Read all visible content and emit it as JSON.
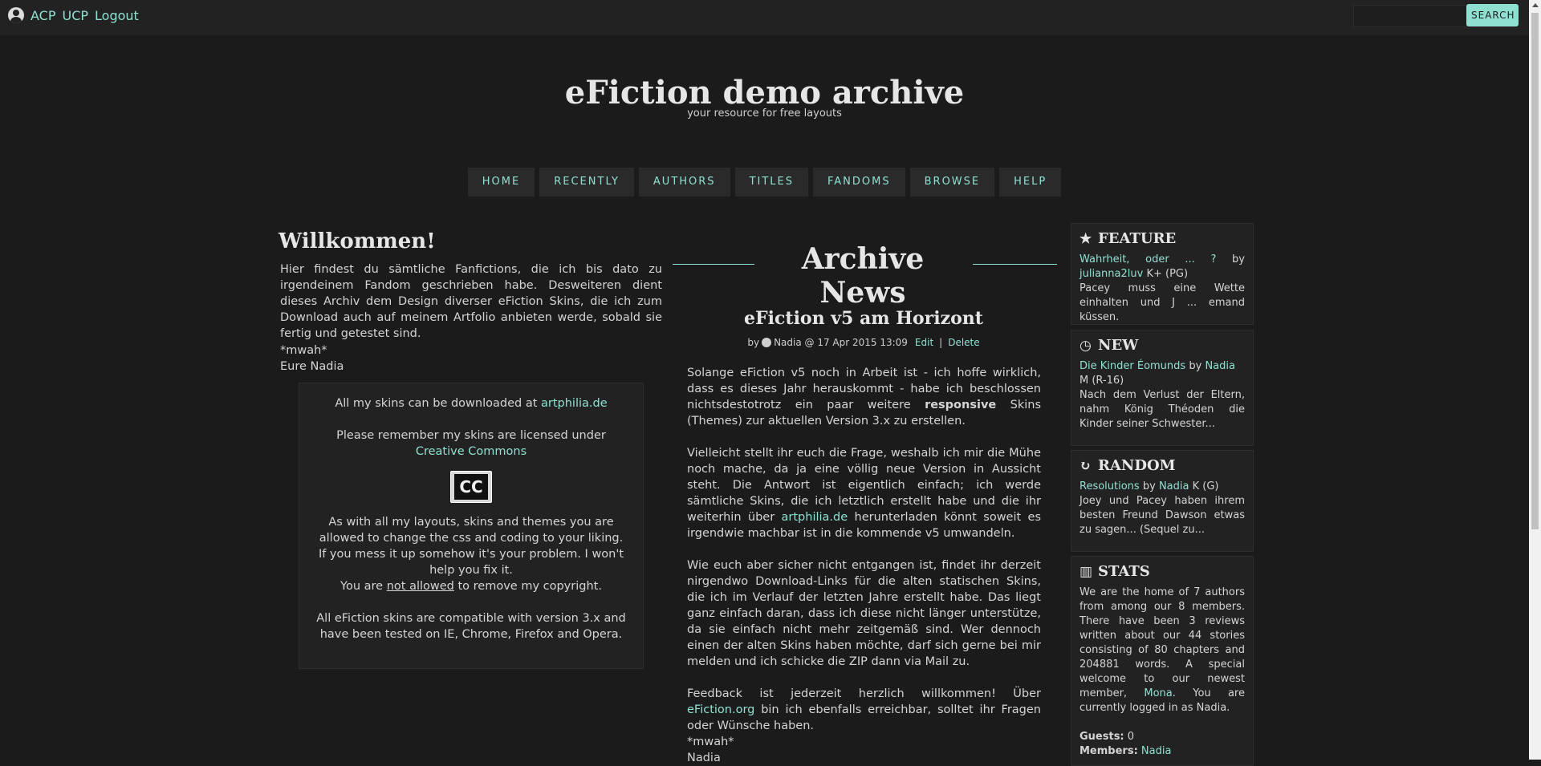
{
  "user_links": [
    "ACP",
    "UCP",
    "Logout"
  ],
  "search": {
    "button": "SEARCH",
    "value": ""
  },
  "header": {
    "title": "eFiction demo archive",
    "tagline": "your resource for free layouts"
  },
  "nav": [
    "HOME",
    "RECENTLY",
    "AUTHORS",
    "TITLES",
    "FANDOMS",
    "BROWSE",
    "HELP"
  ],
  "welcome": {
    "title": "Willkommen!",
    "text": "Hier findest du sämtliche Fanfictions, die ich bis dato zu irgendeinem Fandom geschrieben habe. Desweiteren dient dieses Archiv dem Design diverser eFiction Skins, die ich zum Download auch auf meinem Artfolio anbieten werde, sobald sie fertig und getestet sind.",
    "sig1": "*mwah*",
    "sig2": "Eure Nadia"
  },
  "skin_box": {
    "line1_pre": "All my skins can be downloaded at",
    "line1_link": "artphilia.de",
    "line2_pre": "Please remember my skins are licensed under",
    "line2_link": "Creative Commons",
    "cc": "CC",
    "para1": "As with all my layouts, skins and themes you are allowed to change the css and coding to your liking.",
    "para2": "If you mess it up somehow it's your problem. I won't help you fix it.",
    "para3_pre": "You are",
    "para3_u": "not allowed",
    "para3_post": "to remove my copyright.",
    "para4": "All eFiction skins are compatible with version 3.x and have been tested on IE, Chrome, Firefox and Opera."
  },
  "news": {
    "heading": "Archive News",
    "title": "eFiction v5 am Horizont",
    "meta_by": "by",
    "meta_author": "Nadia @ 17 Apr 2015 13:09",
    "edit": "Edit",
    "sep": "|",
    "delete": "Delete",
    "p1_a": "Solange eFiction v5 noch in Arbeit ist - ich hoffe wirklich, dass es dieses Jahr herauskommt - habe ich beschlossen nichtsdestotrotz ein paar weitere",
    "p1_b": "responsive",
    "p1_c": "Skins (Themes) zur aktuellen Version 3.x zu erstellen.",
    "p2_a": "Vielleicht stellt ihr euch die Frage, weshalb ich mir die Mühe noch mache, da ja eine völlig neue Version in Aussicht steht. Die Antwort ist eigentlich einfach; ich werde sämtliche Skins, die ich letztlich erstellt habe und die ihr weiterhin über",
    "p2_link": "artphilia.de",
    "p2_b": "herunterladen könnt soweit es irgendwie machbar ist in die kommende v5 umwandeln.",
    "p3": "Wie euch aber sicher nicht entgangen ist, findet ihr derzeit nirgendwo Download-Links für die alten statischen Skins, die ich im Verlauf der letzten Jahre erstellt habe. Das liegt ganz einfach daran, dass ich diese nicht länger unterstütze, da sie einfach nicht mehr zeitgemäß sind. Wer dennoch einen der alten Skins haben möchte, darf sich gerne bei mir melden und ich schicke die ZIP dann via Mail zu.",
    "p4_a": "Feedback ist jederzeit herzlich willkommen! Über",
    "p4_link": "eFiction.org",
    "p4_b": "bin ich ebenfalls erreichbar, solltet ihr Fragen oder Wünsche haben.",
    "sig1": "*mwah*",
    "sig2": "Nadia"
  },
  "sidebar": {
    "feature": {
      "title": "FEATURE",
      "story": "Wahrheit, oder ... ?",
      "by": "by",
      "author": "julianna2luv",
      "rating": "K+ (PG)",
      "summary": "Pacey muss eine Wette einhalten und J ... emand küssen."
    },
    "new": {
      "title": "NEW",
      "story": "Die Kinder Éomunds",
      "by": "by",
      "author": "Nadia",
      "rating": "M (R-16)",
      "summary": "Nach dem Verlust der Eltern, nahm König Théoden die Kinder seiner Schwester..."
    },
    "random": {
      "title": "RANDOM",
      "story": "Resolutions",
      "by": "by",
      "author": "Nadia",
      "rating": "K (G)",
      "summary": "Joey und Pacey haben ihrem besten Freund Dawson etwas zu sagen... (Sequel zu..."
    },
    "stats": {
      "title": "STATS",
      "text_a": "We are the home of 7 authors from among our 8 members. There have been 3 reviews written about our 44 stories consisting of 80 chapters and 204881 words. A special welcome to our newest member,",
      "newest": "Mona",
      "text_b": ". You are currently logged in as Nadia.",
      "guests_label": "Guests:",
      "guests": "0",
      "members_label": "Members:",
      "members": "Nadia"
    }
  },
  "icons": {
    "user": "user-circle-icon",
    "feature": "star-icon",
    "new": "clock-icon",
    "random": "refresh-icon",
    "stats": "bar-chart-icon"
  },
  "colors": {
    "background": "#1b1b1b",
    "panel": "#222222",
    "accent": "#8fe0d1",
    "text": "#d4d4d4"
  }
}
